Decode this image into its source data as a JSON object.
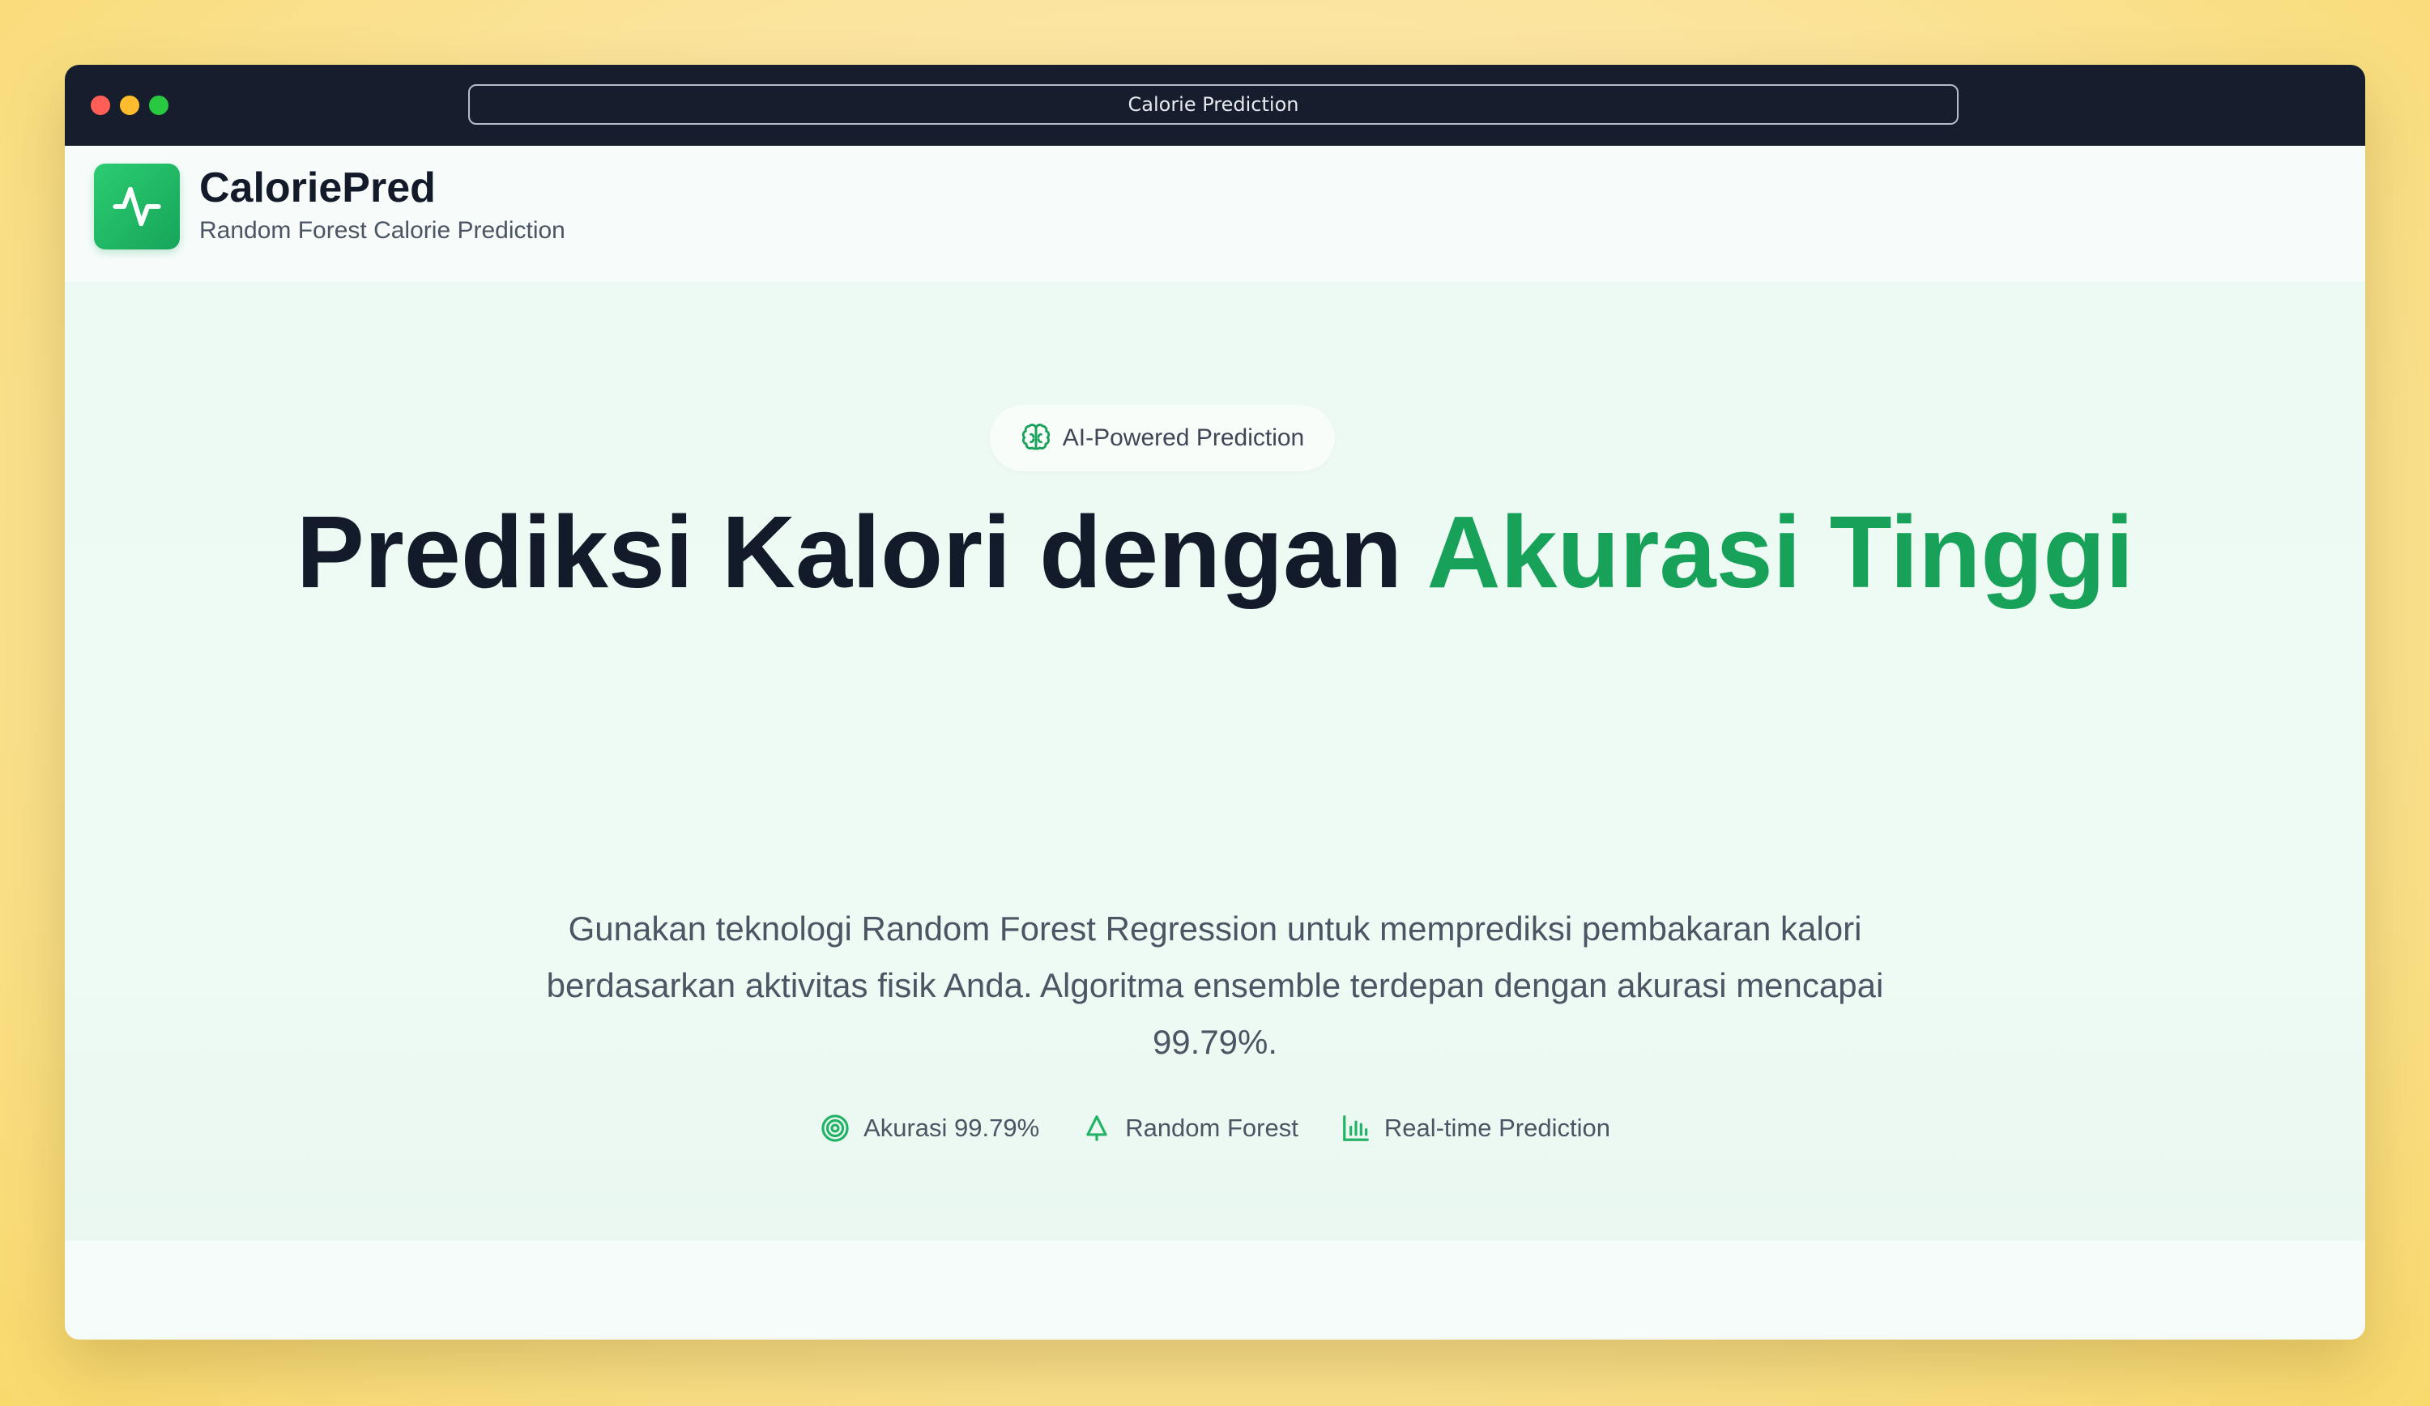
{
  "browser": {
    "url_title": "Calorie Prediction"
  },
  "navbar": {
    "brand_name": "CaloriePred",
    "brand_subtitle": "Random Forest Calorie Prediction",
    "logo_icon": "activity-pulse-icon"
  },
  "hero": {
    "badge": {
      "icon": "brain-icon",
      "label": "AI-Powered Prediction"
    },
    "title_main": "Prediksi Kalori dengan ",
    "title_accent": "Akurasi Tinggi",
    "description": "Gunakan teknologi Random Forest Regression untuk memprediksi pembakaran kalori berdasarkan aktivitas fisik Anda. Algoritma ensemble terdepan dengan akurasi mencapai 99.79%.",
    "features": [
      {
        "icon": "target-icon",
        "label": "Akurasi 99.79%"
      },
      {
        "icon": "tree-icon",
        "label": "Random Forest"
      },
      {
        "icon": "bar-chart-icon",
        "label": "Real-time Prediction"
      }
    ]
  },
  "colors": {
    "accent": "#18a159",
    "dark_text": "#131a2a",
    "titlebar": "#161d2c"
  }
}
